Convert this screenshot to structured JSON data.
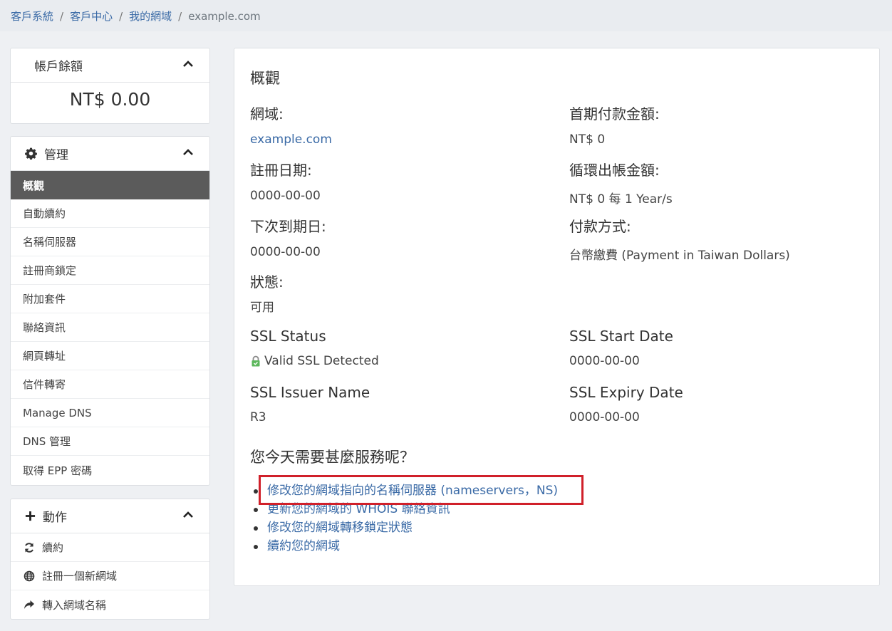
{
  "breadcrumb": {
    "items": [
      "客戶系統",
      "客戶中心",
      "我的網域"
    ],
    "separator": "/",
    "current": "example.com"
  },
  "balance": {
    "title": "帳戶餘額",
    "value": "NT$ 0.00"
  },
  "manage": {
    "title": "管理",
    "items": [
      "概觀",
      "自動續約",
      "名稱伺服器",
      "註冊商鎖定",
      "附加套件",
      "聯絡資訊",
      "網頁轉址",
      "信件轉寄",
      "Manage DNS",
      "DNS 管理",
      "取得 EPP 密碼"
    ],
    "active_index": 0
  },
  "actions": {
    "title": "動作",
    "items": [
      {
        "label": "續約",
        "icon": "refresh-icon"
      },
      {
        "label": "註冊一個新網域",
        "icon": "globe-icon"
      },
      {
        "label": "轉入網域名稱",
        "icon": "share-icon"
      }
    ]
  },
  "overview": {
    "title": "概觀",
    "domain_label": "網域:",
    "domain_value": "example.com",
    "first_payment_label": "首期付款金額:",
    "first_payment_value": "NT$ 0",
    "reg_date_label": "註冊日期:",
    "reg_date_value": "0000-00-00",
    "recurring_label": "循環出帳金額:",
    "recurring_value": "NT$ 0 每 1 Year/s",
    "next_due_label": "下次到期日:",
    "next_due_value": "0000-00-00",
    "payment_method_label": "付款方式:",
    "payment_method_value": "台幣繳費 (Payment in Taiwan Dollars)",
    "status_label": "狀態:",
    "status_value": "可用",
    "ssl_status_label": "SSL Status",
    "ssl_status_value": "Valid SSL Detected",
    "ssl_start_label": "SSL Start Date",
    "ssl_start_value": "0000-00-00",
    "ssl_issuer_label": "SSL Issuer Name",
    "ssl_issuer_value": "R3",
    "ssl_expiry_label": "SSL Expiry Date",
    "ssl_expiry_value": "0000-00-00"
  },
  "help": {
    "title": "您今天需要甚麼服務呢？",
    "links": [
      "修改您的網域指向的名稱伺服器 (nameservers，NS)",
      "更新您的網域的 WHOIS 聯絡資訊",
      "修改您的網域轉移鎖定狀態",
      "續約您的網域"
    ]
  },
  "colors": {
    "link": "#3a6aa6",
    "active_menu": "#5b5b5b",
    "highlight": "#d0202a",
    "ssl_lock": "#5cb85c"
  }
}
